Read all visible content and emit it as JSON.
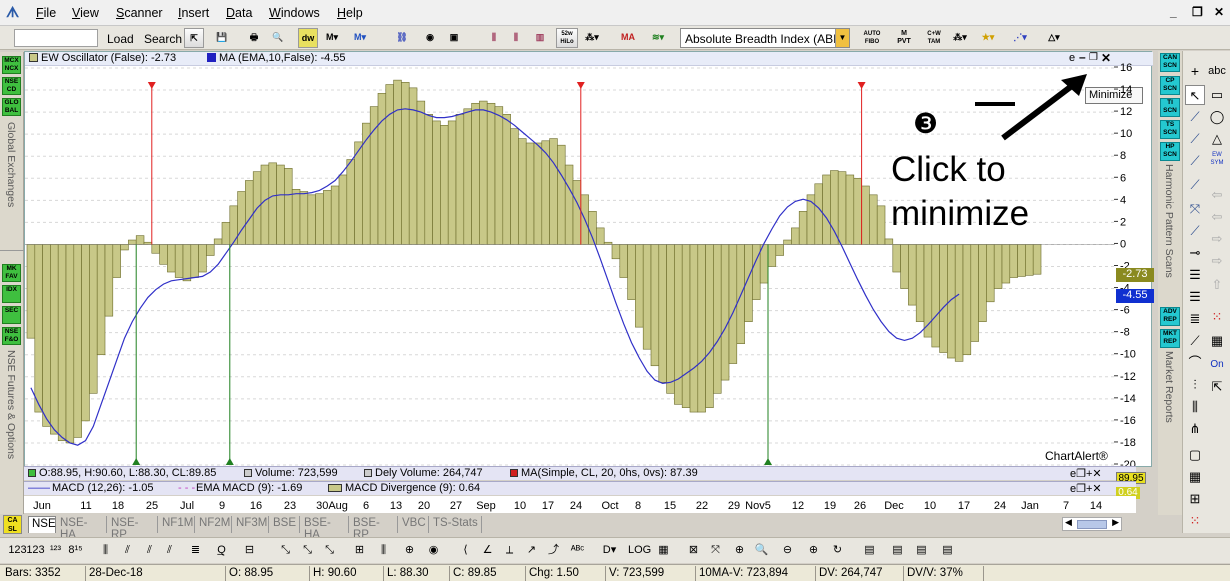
{
  "menubar": {
    "items": [
      "File",
      "View",
      "Scanner",
      "Insert",
      "Data",
      "Windows",
      "Help"
    ]
  },
  "toolbar": {
    "load_label": "Load",
    "search_label": "Search",
    "indicator_select": "Absolute Breadth Index (ABI",
    "icons": {
      "dw": "dw",
      "52w": "52w HiLo",
      "auto_fibo": "AUTO FIBO",
      "mpvt": "M PVT",
      "cam": "C+W TAM"
    }
  },
  "chart": {
    "series_legend_1": "EW Oscillator (False): -2.73",
    "series_legend_2": "MA (EMA,10,False): -4.55",
    "watermark": "ChartAlert®",
    "annotation_number": "❸",
    "annotation_text_line1": "Click to",
    "annotation_text_line2": "minimize",
    "tooltip": "Minimize",
    "current_value_osc": "-2.73",
    "current_value_ma": "-4.55",
    "price_marker_1": "89.95",
    "price_marker_2": "0.64",
    "y_ticks": [
      "16",
      "14",
      "12",
      "10",
      "8",
      "6",
      "4",
      "2",
      "0",
      "-2",
      "-4",
      "-6",
      "-8",
      "-10",
      "-12",
      "-14",
      "-16",
      "-18",
      "-20"
    ],
    "colors": {
      "bar": "#c8c888",
      "bar_border": "#6b6b2a",
      "ma_line": "#3030c8",
      "buy": "#208020",
      "sell": "#e02020"
    }
  },
  "left_panel": {
    "buttons_top": [
      "MCX NCX",
      "NSE CD",
      "GLO BAL"
    ],
    "label_top": "Global Exchanges",
    "buttons_bottom": [
      "MK FAV",
      "IDX",
      "SEC",
      "NSE F&O"
    ],
    "label_bottom": "NSE Futures & Options",
    "bottom_icon": "CA SL"
  },
  "right_panel": {
    "buttons_top": [
      "CAN SCN",
      "CP SCN",
      "TI SCN",
      "TS SCN",
      "HP SCN"
    ],
    "label_top": "Harmonic Pattern Scans",
    "buttons_bottom": [
      "ADV REP",
      "MKT REP"
    ],
    "label_bottom": "Market Reports"
  },
  "drawing_tools": {
    "abc_label": "abc",
    "ew_label": "EW SYM",
    "on_label": "On"
  },
  "subpanels": {
    "price_info": "O:88.95, H:90.60, L:88.30, CL:89.85",
    "volume": "Volume: 723,599",
    "dely_volume": "Dely Volume: 264,747",
    "ma_info": "MA(Simple, CL, 20, 0hs, 0vs): 87.39",
    "macd": "MACD (12,26): -1.05",
    "ema_macd": "EMA MACD (9): -1.69",
    "macd_div": "MACD Divergence (9): 0.64"
  },
  "dates": [
    "Jun",
    "11",
    "18",
    "25",
    "Jul",
    "9",
    "16",
    "23",
    "30Aug",
    "6",
    "13",
    "20",
    "27",
    "Sep",
    "10",
    "17",
    "24",
    "Oct",
    "8",
    "15",
    "22",
    "29",
    "Nov5",
    "12",
    "19",
    "26",
    "Dec",
    "10",
    "17",
    "24",
    "Jan",
    "7",
    "14"
  ],
  "tabs": [
    "NSE",
    "NSE-HA",
    "NSE-RP",
    "NF1M",
    "NF2M",
    "NF3M",
    "BSE",
    "BSE-HA",
    "BSE-RP",
    "VBC",
    "TS-Stats"
  ],
  "statusbar": {
    "bars": "Bars: 3352",
    "date": "28-Dec-18",
    "o": "O: 88.95",
    "h": "H: 90.60",
    "l": "L: 88.30",
    "c": "C: 89.85",
    "chg": "Chg: 1.50",
    "v": "V: 723,599",
    "ma_v": "10MA-V: 723,894",
    "dv": "DV: 264,747",
    "dvv": "DV/V: 37%"
  },
  "chart_data": {
    "type": "bar",
    "title": "",
    "series": [
      {
        "name": "EW Oscillator (False)",
        "values": [
          -8.5,
          -15.2,
          -16.5,
          -17.2,
          -17.8,
          -18.0,
          -17.5,
          -16.0,
          -13.5,
          -10.0,
          -6.5,
          -3.0,
          -0.5,
          0.4,
          0.8,
          0.2,
          -0.8,
          -1.8,
          -2.5,
          -3.0,
          -3.3,
          -3.0,
          -2.5,
          -1.0,
          0.5,
          2.0,
          3.5,
          4.8,
          5.8,
          6.6,
          7.2,
          7.4,
          7.2,
          6.9,
          5.0,
          4.8,
          4.5,
          4.6,
          4.9,
          5.3,
          6.3,
          7.7,
          9.3,
          11.0,
          12.5,
          13.7,
          14.5,
          14.9,
          14.7,
          14.2,
          13.0,
          11.8,
          11.2,
          10.8,
          11.2,
          11.8,
          12.3,
          12.8,
          13.0,
          12.8,
          12.5,
          11.8,
          10.5,
          9.6,
          9.2,
          9.2,
          9.4,
          9.6,
          9.0,
          7.2,
          5.8,
          4.5,
          3.0,
          1.5,
          0.2,
          -1.3,
          -3.0,
          -5.0,
          -7.5,
          -9.5,
          -11.0,
          -12.5,
          -13.5,
          -14.5,
          -14.8,
          -15.2,
          -15.2,
          -14.8,
          -13.5,
          -12.3,
          -10.8,
          -9.0,
          -7.0,
          -5.0,
          -3.5,
          -2.0,
          -1.0,
          0.4,
          1.5,
          3.0,
          4.5,
          5.5,
          6.3,
          6.7,
          6.6,
          6.3,
          6.0,
          5.3,
          4.5,
          3.5,
          0.5,
          -2.5,
          -4.0,
          -5.5,
          -7.0,
          -8.4,
          -9.3,
          -9.8,
          -10.3,
          -10.6,
          -10.0,
          -8.8,
          -7.0,
          -5.2,
          -4.0,
          -3.5,
          -3.0,
          -2.9,
          -2.8,
          -2.7
        ]
      },
      {
        "name": "MA (EMA,10,False)",
        "values": [
          -13,
          -14.5,
          -15.8,
          -16.8,
          -17.5,
          -18.0,
          -18.2,
          -17.8,
          -16.5,
          -14.5,
          -12.5,
          -10.5,
          -8.5,
          -7.0,
          -5.8,
          -4.8,
          -4.1,
          -3.6,
          -3.3,
          -3.2,
          -3.1,
          -3.0,
          -2.9,
          -2.5,
          -1.8,
          -0.8,
          0.2,
          1.3,
          2.3,
          3.3,
          4.0,
          4.4,
          4.5,
          4.5,
          4.6,
          4.6,
          4.7,
          4.9,
          5.3,
          5.8,
          6.6,
          7.5,
          8.5,
          9.5,
          10.4,
          11.2,
          11.8,
          12.2,
          12.3,
          12.2,
          12.0,
          11.7,
          11.5,
          11.5,
          11.6,
          11.8,
          12.0,
          12.2,
          12.2,
          12.0,
          11.7,
          11.3,
          10.8,
          10.2,
          9.6,
          9.0,
          8.3,
          7.4,
          6.3,
          5.1,
          3.8,
          2.3,
          0.6,
          -1.3,
          -3.3,
          -5.3,
          -7.2,
          -8.9,
          -10.3,
          -11.5,
          -12.3,
          -12.6,
          -12.5,
          -12.2,
          -11.7,
          -11.2,
          -10.6,
          -9.8,
          -8.8,
          -7.6,
          -6.2,
          -4.6,
          -3.0,
          -1.4,
          0.1,
          1.4,
          2.6,
          3.4,
          3.9,
          4.1,
          3.9,
          3.3,
          2.4,
          1.2,
          -0.2,
          -1.7,
          -3.2,
          -4.6,
          -5.9,
          -7.0,
          -7.9,
          -8.5,
          -8.7,
          -8.5,
          -8.0,
          -7.3,
          -6.5,
          -5.7,
          -5.0,
          -4.5
        ]
      }
    ],
    "ylim": [
      -20,
      16
    ],
    "signals": {
      "buy": [
        "Jun 18-25",
        "Jul 9",
        "Nov5"
      ],
      "sell": [
        "Jun 25",
        "Oct",
        "Nov 26"
      ]
    }
  }
}
